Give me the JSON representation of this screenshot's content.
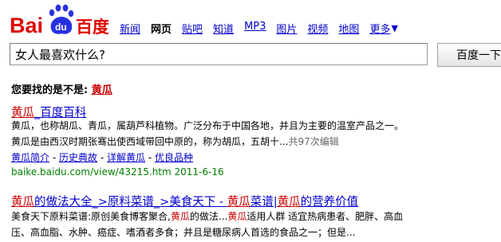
{
  "logo": {
    "text_left": "Bai",
    "paw": "du",
    "text_right": "百度"
  },
  "nav": [
    {
      "label": "新闻",
      "current": false
    },
    {
      "label": "网页",
      "current": true
    },
    {
      "label": "贴吧",
      "current": false
    },
    {
      "label": "知道",
      "current": false
    },
    {
      "label": "MP3",
      "current": false
    },
    {
      "label": "图片",
      "current": false
    },
    {
      "label": "视频",
      "current": false
    },
    {
      "label": "地图",
      "current": false
    },
    {
      "label": "更多",
      "current": false
    }
  ],
  "search": {
    "value": "女人最喜欢什么?",
    "button": "百度一下"
  },
  "suggestion": {
    "prefix": "您要找的是不是:",
    "term": "黄瓜"
  },
  "result1": {
    "title_kw": "黄瓜",
    "title_rest": "_百度百科",
    "line1": "黄瓜，也称胡瓜、青瓜，属葫芦科植物。广泛分布于中国各地，并且为主要的温室产品之一。",
    "line2": "黄瓜是由西汉时期张骞出使西域带回中原的，称为胡瓜，五胡十...",
    "line2_meta": "共97次编辑",
    "sub": [
      "黄瓜简介",
      "历史典故",
      "详解黄瓜",
      "优良品种"
    ],
    "sub_sep": "-",
    "url": "baike.baidu.com/view/43215.htm 2011-6-16"
  },
  "result2": {
    "t1": "黄瓜",
    "t2": "的做法大全_>原料菜谱_>美食天下 - ",
    "t3": "黄瓜",
    "t4": "菜谱|",
    "t5": "黄瓜",
    "t6": "的营养价值",
    "l1a": "美食天下原料菜谱:原创美食博客聚合,",
    "l1b": "黄瓜",
    "l1c": "的做法...",
    "l1d": "黄瓜",
    "l1e": "适用人群 适宜热病患者、肥胖、高血",
    "line2": "压、高血脂、水肿、癌症、嗜酒者多食；并且是糖尿病人首选的食品之一；但是..."
  },
  "colors": {
    "link": "#0000cc",
    "keyword": "#cc0000",
    "url": "#008000",
    "logo_red": "#e10601",
    "logo_blue": "#2932e1"
  }
}
